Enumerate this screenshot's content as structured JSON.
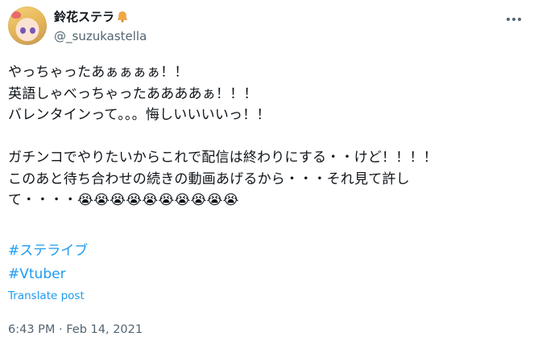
{
  "user": {
    "display_name": "鈴花ステラ",
    "display_name_emoji": "🔔",
    "handle": "@_suzukastella"
  },
  "post": {
    "text": "やっちゃったあぁぁぁぁ！！\n英語しゃべっちゃったああああぁ！！！\nバレンタインって。。。悔しいいいいっ！！\n\nガチンコでやりたいからこれで配信は終わりにする・・けど！！！！\nこのあと待ち合わせの続きの動画あげるから・・・それ見て許し\nて・・・・😭😭😭😭😭😭😭😭😭😭",
    "hashtags": [
      "#ステライブ",
      "#Vtuber"
    ],
    "translate_label": "Translate post",
    "timestamp": "6:43 PM · Feb 14, 2021"
  },
  "icons": {
    "avatar": "avatar",
    "bell": "bell-icon",
    "more": "more-icon"
  },
  "colors": {
    "accent": "#1d9bf0",
    "secondary_text": "#536471",
    "primary_text": "#0f1419"
  }
}
